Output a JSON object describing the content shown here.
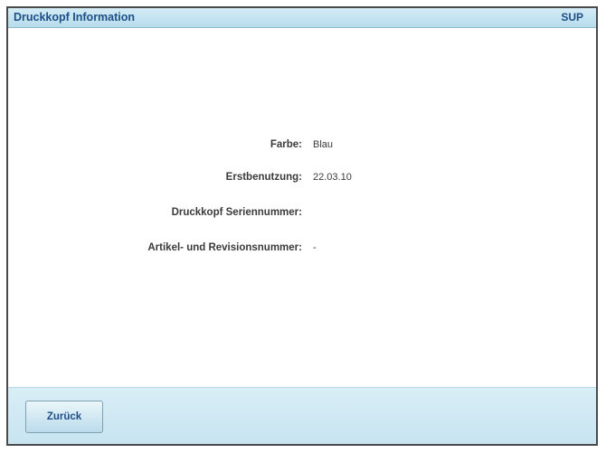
{
  "header": {
    "title": "Druckkopf Information",
    "user": "SUP"
  },
  "info": {
    "rows": [
      {
        "label": "Farbe:",
        "value": "Blau"
      },
      {
        "label": "Erstbenutzung:",
        "value": "22.03.10"
      },
      {
        "label": "Druckkopf Seriennummer:",
        "value": ""
      },
      {
        "label": "Artikel- und Revisionsnummer:",
        "value": "-"
      }
    ]
  },
  "footer": {
    "back_label": "Zurück"
  },
  "colors": {
    "title_text": "#1d4e86",
    "header_bg": "#c5e5f2",
    "footer_bg": "#d0e8f3",
    "frame_border": "#4a4a4a",
    "label_text": "#3a3a3a"
  }
}
